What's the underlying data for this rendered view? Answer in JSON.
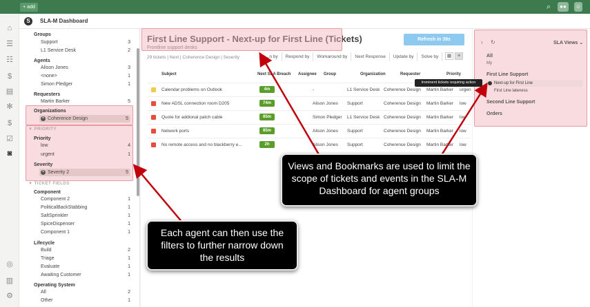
{
  "topbar": {
    "add_label": "+ add"
  },
  "header": {
    "logo": "S",
    "title": "SLA-M Dashboard"
  },
  "sidebar": {
    "groups_title": "Groups",
    "groups": [
      {
        "label": "Support",
        "count": "3"
      },
      {
        "label": "L1 Service Desk",
        "count": "2"
      }
    ],
    "agents_title": "Agents",
    "agents": [
      {
        "label": "Alison Jones",
        "count": "3"
      },
      {
        "label": "<none>",
        "count": "1"
      },
      {
        "label": "Simon Pledger",
        "count": "1"
      }
    ],
    "requesters_title": "Requesters",
    "requesters": [
      {
        "label": "Martin Barker",
        "count": "5"
      }
    ],
    "organizations_title": "Organizations",
    "organization_selected": {
      "label": "Coherence Design",
      "count": "5"
    },
    "priority_category": "▼ PRIORITY",
    "priority_title": "Priority",
    "priorities": [
      {
        "label": "low",
        "count": "4"
      },
      {
        "label": "urgent",
        "count": "1"
      }
    ],
    "severity_title": "Severity",
    "severity_selected": {
      "label": "Severity 2",
      "count": "5"
    },
    "ticket_fields_category": "▼ TICKET FIELDS",
    "component_title": "Component",
    "components": [
      {
        "label": "Component 2",
        "count": "1"
      },
      {
        "label": "PoliticalBackStabbing",
        "count": "1"
      },
      {
        "label": "SaltSprinkler",
        "count": "1"
      },
      {
        "label": "SpiceDispenser",
        "count": "1"
      },
      {
        "label": "Component 1",
        "count": "1"
      }
    ],
    "lifecycle_title": "Lifecycle",
    "lifecycles": [
      {
        "label": "Build",
        "count": "2"
      },
      {
        "label": "Triage",
        "count": "1"
      },
      {
        "label": "Evaluate",
        "count": "1"
      },
      {
        "label": "Awaiting Customer",
        "count": "1"
      }
    ],
    "os_title": "Operating System",
    "os": [
      {
        "label": "All",
        "count": "2"
      },
      {
        "label": "Other",
        "count": "1"
      }
    ]
  },
  "main": {
    "title": "First Line Support - Next-up for First Line  (Tickets)",
    "subtitle": "Frontline support desks",
    "refresh_label": "Refresh in 39s",
    "crumb": "29 tickets | Next | Coherence Design | Severity",
    "tabs": [
      "...n by",
      "Respond by",
      "Workaround by",
      "Next Response",
      "Update by",
      "Solve by"
    ],
    "columns": {
      "subject": "Subject",
      "sla": "Next SLA Breach",
      "assignee": "Assignee",
      "group": "Group",
      "org": "Organization",
      "requester": "Requester",
      "priority": "Priority"
    },
    "rows": [
      {
        "subject": "Calendar problems on Outlook",
        "sla": "4m",
        "assignee": "",
        "group": "-",
        "org": "L1 Service Desk",
        "org2": "Coherence Design",
        "requester": "Martin Barker",
        "priority": "urgen"
      },
      {
        "subject": "New ADSL connection room D205",
        "sla": "74m",
        "assignee": "Alison Jones",
        "group": "Support",
        "org": "",
        "org2": "Coherence Design",
        "requester": "Martin Barker",
        "priority": "low"
      },
      {
        "subject": "Quote for addional patch cable",
        "sla": "85m",
        "assignee": "Simon Pledger",
        "group": "L1 Service Desk",
        "org": "",
        "org2": "Coherence Design",
        "requester": "Martin Barker",
        "priority": "low"
      },
      {
        "subject": "Network ports",
        "sla": "85m",
        "assignee": "Alison Jones",
        "group": "Support",
        "org": "",
        "org2": "Coherence Design",
        "requester": "Martin Barker",
        "priority": "low"
      },
      {
        "subject": "No remote access and no blackberry e...",
        "sla": "2h",
        "assignee": "Alison Jones",
        "group": "Support",
        "org": "",
        "org2": "Coherence Design",
        "requester": "Martin Barker",
        "priority": "low"
      }
    ]
  },
  "rightpanel": {
    "views_label": "SLA Views ⌄",
    "all": "All",
    "my": "My",
    "first_line": "First Line Support",
    "next_up": "Next-up for First Line",
    "lateness": "First Line lateness",
    "second_line": "Second Line Support",
    "orders": "Orders",
    "tooltip": "Imminent tickets requiring action"
  },
  "callouts": {
    "views": "Views and Bookmarks are used to limit the scope of tickets and events in the SLA-M Dashboard for agent groups",
    "filters": "Each agent can then use the filters to further narrow down the results"
  },
  "colors": {
    "topbar": "#3d7b4f",
    "sla_green": "#5b9d2b",
    "highlight": "#f2b2b8",
    "arrow": "#c0000a"
  }
}
